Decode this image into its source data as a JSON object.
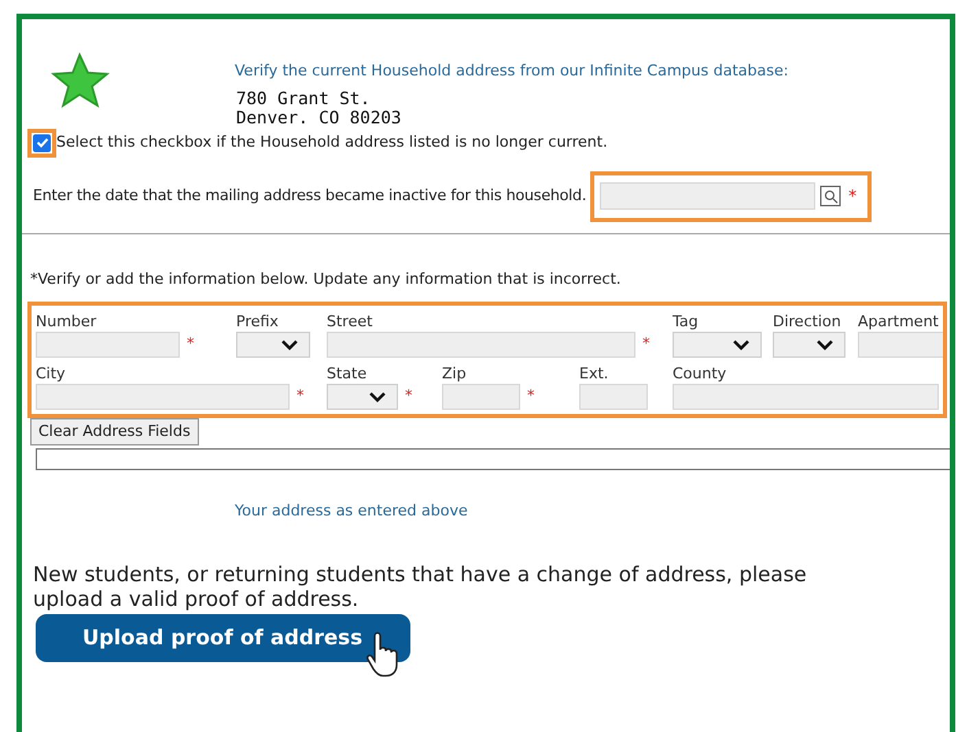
{
  "intro": {
    "heading": "Verify the current Household address from our Infinite Campus database:",
    "address_lines": [
      "780 Grant St.",
      "Denver. CO 80203"
    ]
  },
  "inactive_checkbox": {
    "label": "Select this checkbox if the Household address listed is no longer current.",
    "checked": true
  },
  "inactive_date": {
    "label": "Enter the date that the mailing address became inactive for this household.",
    "required_mark": "*"
  },
  "instructions": "*Verify or add the information below. Update any information that is incorrect.",
  "address_rows": [
    [
      {
        "label": "Number",
        "kind": "text",
        "required_mark": "*"
      },
      {
        "label": "Prefix",
        "kind": "select"
      },
      {
        "label": "Street",
        "kind": "text",
        "required_mark": "*"
      },
      {
        "label": "Tag",
        "kind": "select"
      },
      {
        "label": "Direction",
        "kind": "select"
      },
      {
        "label": "Apartment",
        "kind": "text"
      }
    ],
    [
      {
        "label": "City",
        "kind": "text",
        "required_mark": "*"
      },
      {
        "label": "State",
        "kind": "select",
        "required_mark": "*"
      },
      {
        "label": "Zip",
        "kind": "text",
        "required_mark": "*"
      },
      {
        "label": "Ext.",
        "kind": "text"
      },
      {
        "label": "County",
        "kind": "text"
      }
    ]
  ],
  "clear_button": "Clear Address Fields",
  "map_caption": "Your address as entered above",
  "proof_text": "New students, or returning students that have a change of address, please upload a valid proof of address.",
  "upload_button": "Upload proof of address"
}
